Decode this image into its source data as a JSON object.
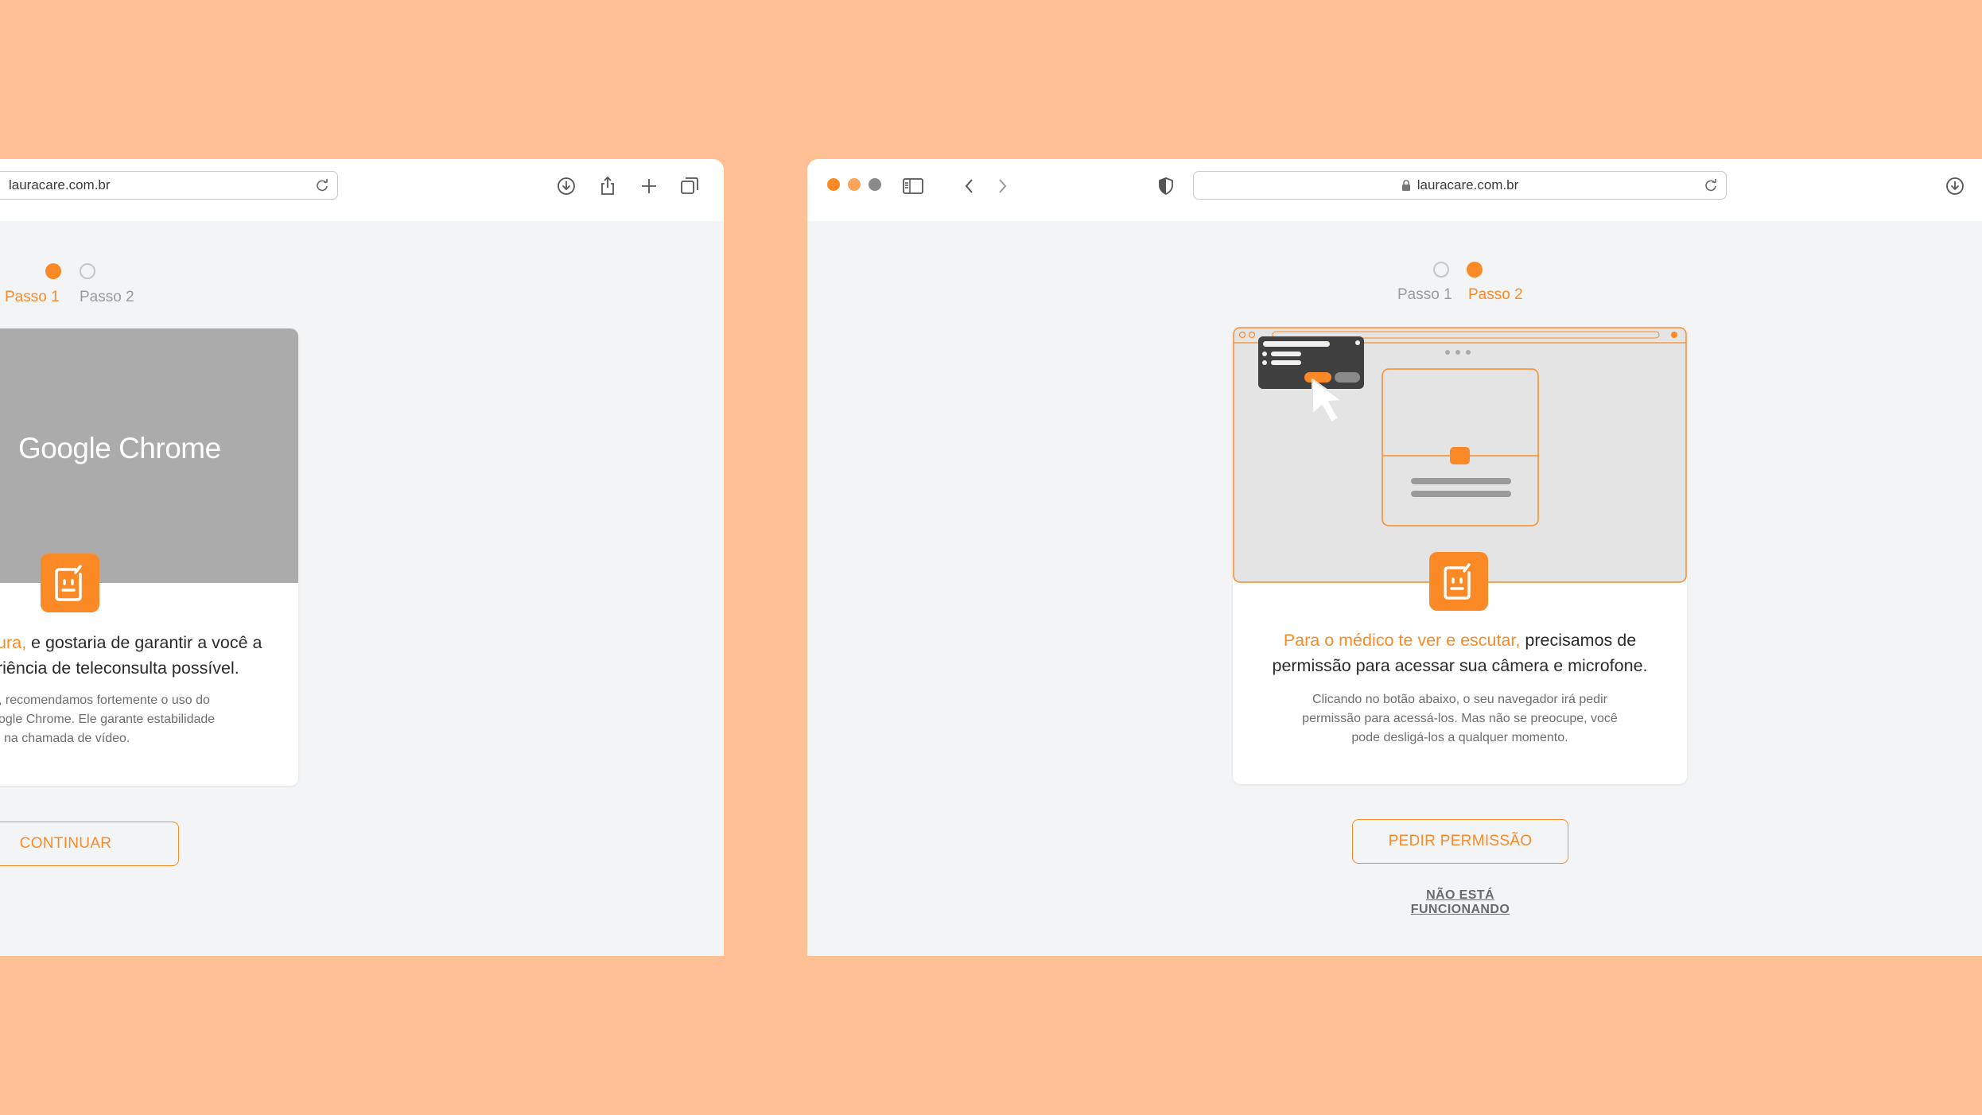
{
  "left_window": {
    "url": "lauracare.com.br",
    "steps": [
      {
        "label": "Passo 1",
        "active": true
      },
      {
        "label": "Passo 2",
        "active": false
      }
    ],
    "hero_logo": "Google Chrome",
    "headline_highlight": "ura,",
    "headline_line1_rest": " e gostaria de garantir a você a",
    "headline_line2": "riência de teleconsulta possível.",
    "desc_lines": [
      ", recomendamos fortemente o uso do",
      "ogle Chrome. Ele garante estabilidade",
      "na chamada de vídeo."
    ],
    "button": "CONTINUAR"
  },
  "right_window": {
    "url": "lauracare.com.br",
    "steps": [
      {
        "label": "Passo 1",
        "active": false
      },
      {
        "label": "Passo 2",
        "active": true
      }
    ],
    "headline_highlight": "Para o médico te ver e escutar,",
    "headline_line1_rest": " precisamos de",
    "headline_line2": "permissão para acessar sua câmera e microfone.",
    "desc_lines": [
      "Clicando no botão abaixo, o seu navegador irá pedir",
      "permissão para acessá-los. Mas não se preocupe, você",
      "pode desligá-los a qualquer momento."
    ],
    "button": "PEDIR PERMISSÃO",
    "link": "NÃO ESTÁ FUNCIONANDO"
  },
  "icons": {
    "toolbar_left": [
      "download-icon",
      "share-icon",
      "new-tab-icon",
      "tabs-overview-icon"
    ],
    "toolbar_right": [
      "sidebar-icon",
      "back-icon",
      "forward-icon",
      "privacy-shield-icon",
      "lock-icon",
      "reload-icon",
      "download-icon"
    ],
    "app": "lauracare-app-icon"
  },
  "colors": {
    "background": "#FFC096",
    "accent": "#FB8A26",
    "window_bg": "#F3F4F6",
    "hero_gray": "#ABABAB",
    "illustration_bg": "#E4E4E4",
    "traffic_lights": [
      "#FB8A26",
      "#FBA55A",
      "#8A8A8A"
    ]
  }
}
